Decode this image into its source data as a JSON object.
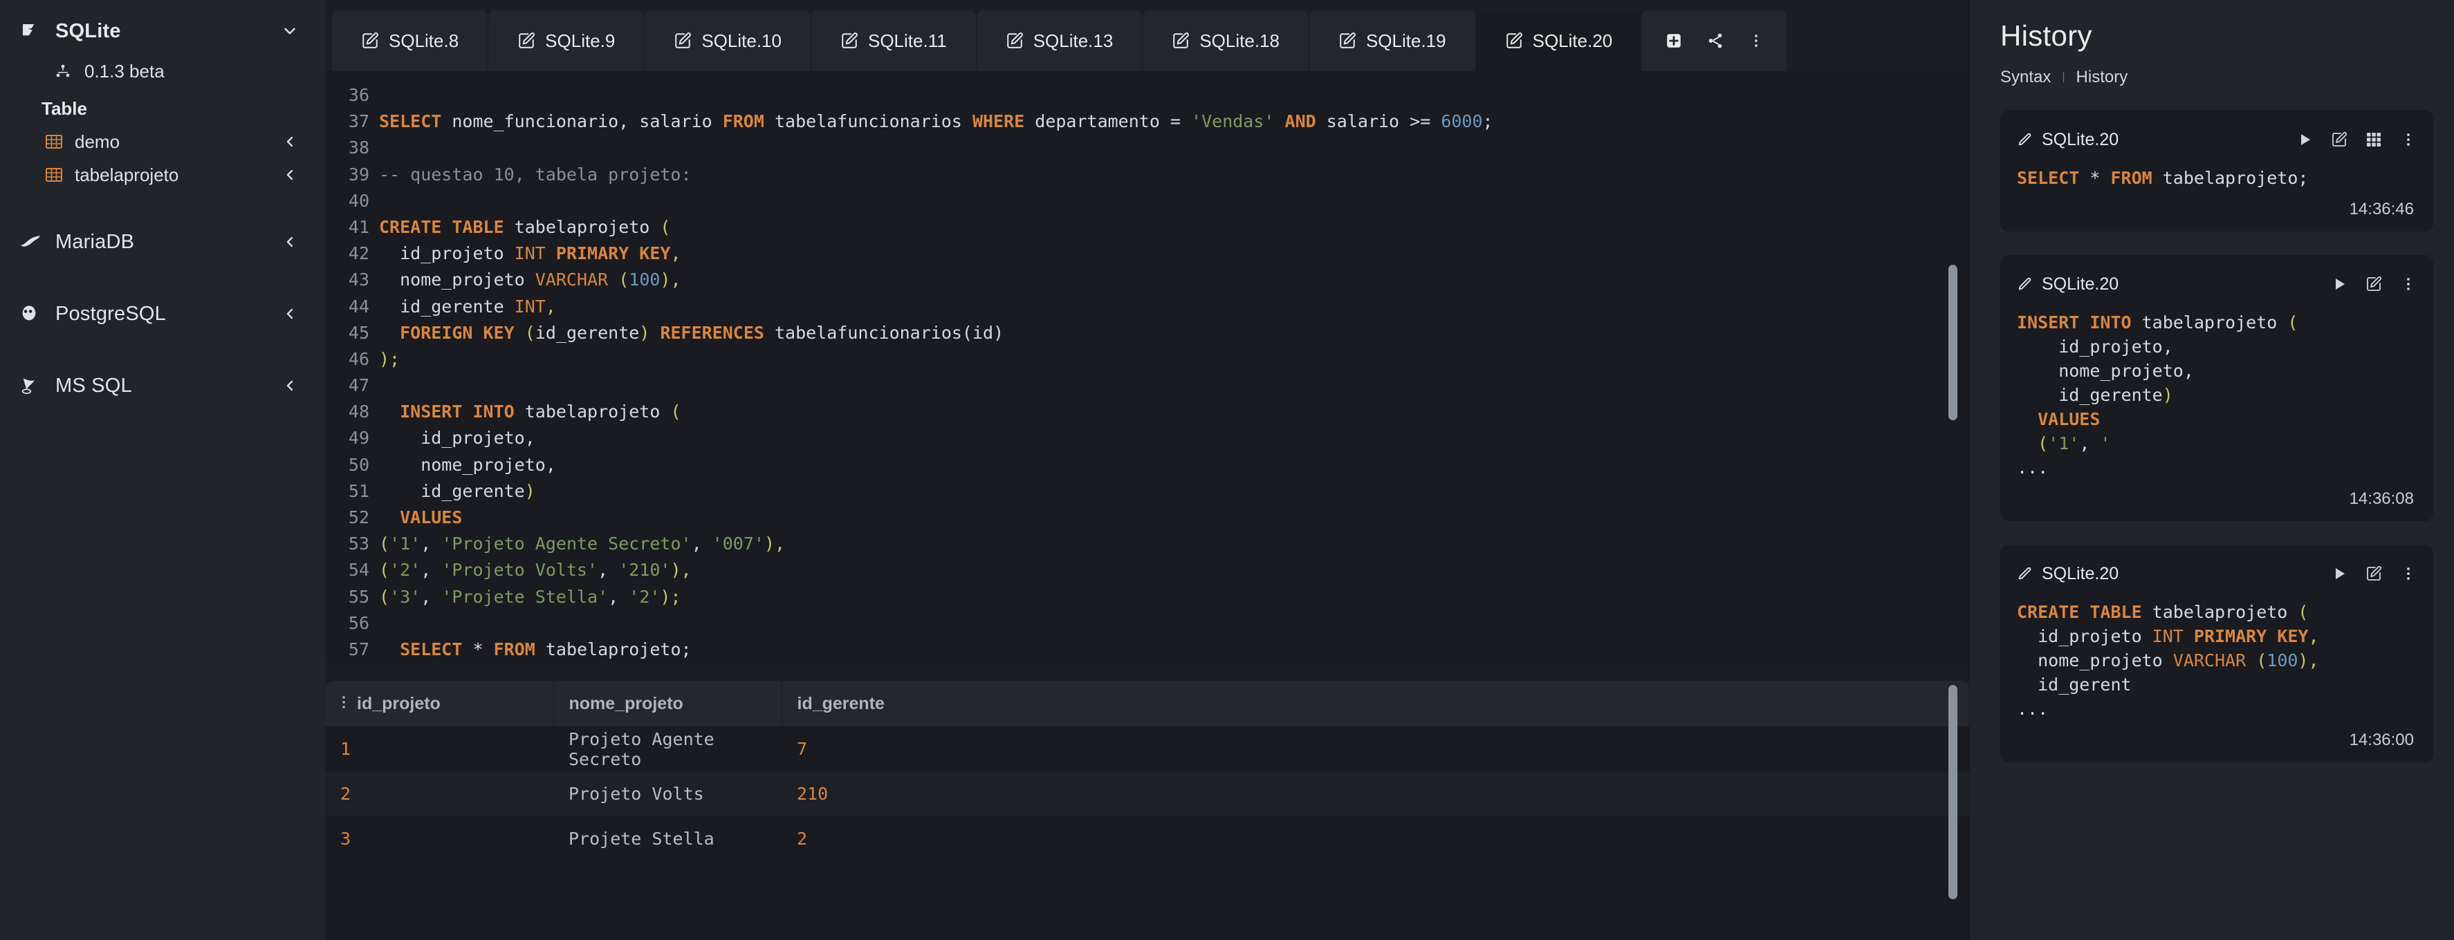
{
  "sidebar": {
    "groups": [
      {
        "name": "SQLite",
        "icon": "sqlite-feather-icon",
        "expanded": true,
        "chevron": "chevron-down-icon",
        "connection": {
          "label": "0.1.3 beta",
          "icon": "connection-node-icon"
        },
        "section_label": "Table",
        "tables": [
          {
            "label": "demo",
            "icon": "table-grid-icon",
            "chevron": "chevron-left-icon"
          },
          {
            "label": "tabelaprojeto",
            "icon": "table-grid-icon",
            "chevron": "chevron-left-icon"
          }
        ]
      },
      {
        "name": "MariaDB",
        "icon": "mariadb-seal-icon",
        "expanded": false,
        "chevron": "chevron-left-icon"
      },
      {
        "name": "PostgreSQL",
        "icon": "postgresql-elephant-icon",
        "expanded": false,
        "chevron": "chevron-left-icon"
      },
      {
        "name": "MS SQL",
        "icon": "mssql-server-icon",
        "expanded": false,
        "chevron": "chevron-left-icon"
      }
    ]
  },
  "tabs": {
    "items": [
      {
        "label": "SQLite.8",
        "icon": "edit-note-icon",
        "active": false
      },
      {
        "label": "SQLite.9",
        "icon": "edit-note-icon",
        "active": false
      },
      {
        "label": "SQLite.10",
        "icon": "edit-note-icon",
        "active": false
      },
      {
        "label": "SQLite.11",
        "icon": "edit-note-icon",
        "active": false
      },
      {
        "label": "SQLite.13",
        "icon": "edit-note-icon",
        "active": false
      },
      {
        "label": "SQLite.18",
        "icon": "edit-note-icon",
        "active": false
      },
      {
        "label": "SQLite.19",
        "icon": "edit-note-icon",
        "active": false
      },
      {
        "label": "SQLite.20",
        "icon": "edit-note-icon",
        "active": true
      }
    ],
    "actions": [
      {
        "name": "add-tab-button",
        "icon": "plus-square-icon"
      },
      {
        "name": "share-button",
        "icon": "share-nodes-icon"
      },
      {
        "name": "more-options-button",
        "icon": "kebab-menu-icon"
      }
    ]
  },
  "editor": {
    "first_line_number": 36,
    "lines": [
      {
        "n": 36,
        "tokens": []
      },
      {
        "n": 37,
        "tokens": [
          {
            "t": "kw",
            "v": "SELECT"
          },
          {
            "t": "pln",
            "v": " nome_funcionario, salario "
          },
          {
            "t": "kw",
            "v": "FROM"
          },
          {
            "t": "pln",
            "v": " tabelafuncionarios "
          },
          {
            "t": "kw",
            "v": "WHERE"
          },
          {
            "t": "pln",
            "v": " departamento = "
          },
          {
            "t": "str",
            "v": "'Vendas'"
          },
          {
            "t": "pln",
            "v": " "
          },
          {
            "t": "kw",
            "v": "AND"
          },
          {
            "t": "pln",
            "v": " salario >= "
          },
          {
            "t": "num",
            "v": "6000"
          },
          {
            "t": "pln",
            "v": ";"
          }
        ]
      },
      {
        "n": 38,
        "tokens": []
      },
      {
        "n": 39,
        "tokens": [
          {
            "t": "com",
            "v": "-- questao 10, tabela projeto:"
          }
        ]
      },
      {
        "n": 40,
        "tokens": []
      },
      {
        "n": 41,
        "tokens": [
          {
            "t": "kw",
            "v": "CREATE TABLE"
          },
          {
            "t": "pln",
            "v": " tabelaprojeto "
          },
          {
            "t": "par",
            "v": "("
          }
        ]
      },
      {
        "n": 42,
        "tokens": [
          {
            "t": "pln",
            "v": "  id_projeto "
          },
          {
            "t": "typ",
            "v": "INT"
          },
          {
            "t": "pln",
            "v": " "
          },
          {
            "t": "kw",
            "v": "PRIMARY KEY"
          },
          {
            "t": "par",
            "v": ","
          }
        ]
      },
      {
        "n": 43,
        "tokens": [
          {
            "t": "pln",
            "v": "  nome_projeto "
          },
          {
            "t": "typ",
            "v": "VARCHAR"
          },
          {
            "t": "pln",
            "v": " "
          },
          {
            "t": "par",
            "v": "("
          },
          {
            "t": "num",
            "v": "100"
          },
          {
            "t": "par",
            "v": "),"
          }
        ]
      },
      {
        "n": 44,
        "tokens": [
          {
            "t": "pln",
            "v": "  id_gerente "
          },
          {
            "t": "typ",
            "v": "INT"
          },
          {
            "t": "par",
            "v": ","
          }
        ]
      },
      {
        "n": 45,
        "tokens": [
          {
            "t": "kw",
            "v": "  FOREIGN KEY"
          },
          {
            "t": "pln",
            "v": " "
          },
          {
            "t": "par",
            "v": "("
          },
          {
            "t": "pln",
            "v": "id_gerente"
          },
          {
            "t": "par",
            "v": ")"
          },
          {
            "t": "pln",
            "v": " "
          },
          {
            "t": "kw",
            "v": "REFERENCES"
          },
          {
            "t": "pln",
            "v": " tabelafuncionarios(id)"
          }
        ]
      },
      {
        "n": 46,
        "tokens": [
          {
            "t": "par",
            "v": ");"
          }
        ]
      },
      {
        "n": 47,
        "tokens": []
      },
      {
        "n": 48,
        "tokens": [
          {
            "t": "kw",
            "v": "  INSERT INTO"
          },
          {
            "t": "pln",
            "v": " tabelaprojeto "
          },
          {
            "t": "par",
            "v": "("
          }
        ]
      },
      {
        "n": 49,
        "tokens": [
          {
            "t": "pln",
            "v": "    id_projeto,"
          }
        ]
      },
      {
        "n": 50,
        "tokens": [
          {
            "t": "pln",
            "v": "    nome_projeto,"
          }
        ]
      },
      {
        "n": 51,
        "tokens": [
          {
            "t": "pln",
            "v": "    id_gerente"
          },
          {
            "t": "par",
            "v": ")"
          }
        ]
      },
      {
        "n": 52,
        "tokens": [
          {
            "t": "kw",
            "v": "  VALUES"
          }
        ]
      },
      {
        "n": 53,
        "tokens": [
          {
            "t": "par",
            "v": "("
          },
          {
            "t": "str",
            "v": "'1'"
          },
          {
            "t": "pln",
            "v": ", "
          },
          {
            "t": "str",
            "v": "'Projeto Agente Secreto'"
          },
          {
            "t": "pln",
            "v": ", "
          },
          {
            "t": "str",
            "v": "'007'"
          },
          {
            "t": "par",
            "v": "),"
          }
        ]
      },
      {
        "n": 54,
        "tokens": [
          {
            "t": "par",
            "v": "("
          },
          {
            "t": "str",
            "v": "'2'"
          },
          {
            "t": "pln",
            "v": ", "
          },
          {
            "t": "str",
            "v": "'Projeto Volts'"
          },
          {
            "t": "pln",
            "v": ", "
          },
          {
            "t": "str",
            "v": "'210'"
          },
          {
            "t": "par",
            "v": "),"
          }
        ]
      },
      {
        "n": 55,
        "tokens": [
          {
            "t": "par",
            "v": "("
          },
          {
            "t": "str",
            "v": "'3'"
          },
          {
            "t": "pln",
            "v": ", "
          },
          {
            "t": "str",
            "v": "'Projete Stella'"
          },
          {
            "t": "pln",
            "v": ", "
          },
          {
            "t": "str",
            "v": "'2'"
          },
          {
            "t": "par",
            "v": ");"
          }
        ]
      },
      {
        "n": 56,
        "tokens": []
      },
      {
        "n": 57,
        "tokens": [
          {
            "t": "kw",
            "v": "  SELECT"
          },
          {
            "t": "pln",
            "v": " * "
          },
          {
            "t": "kw",
            "v": "FROM"
          },
          {
            "t": "pln",
            "v": " tabelaprojeto;"
          }
        ]
      }
    ]
  },
  "results": {
    "columns": [
      "id_projeto",
      "nome_projeto",
      "id_gerente"
    ],
    "rows": [
      [
        "1",
        "Projeto Agente Secreto",
        "7"
      ],
      [
        "2",
        "Projeto Volts",
        "210"
      ],
      [
        "3",
        "Projete Stella",
        "2"
      ]
    ]
  },
  "history": {
    "title": "History",
    "tabs": [
      {
        "label": "Syntax",
        "active": false
      },
      {
        "label": "History",
        "active": true
      }
    ],
    "separator": "|",
    "cards": [
      {
        "title": "SQLite.20",
        "icons": [
          "run-icon",
          "edit-icon",
          "grid-icon",
          "kebab-menu-icon"
        ],
        "time": "14:36:46",
        "sql": [
          [
            {
              "t": "kw",
              "v": "SELECT"
            },
            {
              "t": "pln",
              "v": " * "
            },
            {
              "t": "kw",
              "v": "FROM"
            },
            {
              "t": "pln",
              "v": " tabelaprojeto;"
            }
          ]
        ]
      },
      {
        "title": "SQLite.20",
        "icons": [
          "run-icon",
          "edit-icon",
          "kebab-menu-icon"
        ],
        "time": "14:36:08",
        "sql": [
          [
            {
              "t": "kw",
              "v": "INSERT INTO"
            },
            {
              "t": "pln",
              "v": " tabelaprojeto "
            },
            {
              "t": "par",
              "v": "("
            }
          ],
          [
            {
              "t": "pln",
              "v": "    id_projeto,"
            }
          ],
          [
            {
              "t": "pln",
              "v": "    nome_projeto,"
            }
          ],
          [
            {
              "t": "pln",
              "v": "    id_gerente"
            },
            {
              "t": "par",
              "v": ")"
            }
          ],
          [
            {
              "t": "kw",
              "v": "  VALUES"
            }
          ],
          [
            {
              "t": "par",
              "v": "  ("
            },
            {
              "t": "str",
              "v": "'1'"
            },
            {
              "t": "pln",
              "v": ", "
            },
            {
              "t": "str",
              "v": "'"
            }
          ],
          [
            {
              "t": "pln",
              "v": "..."
            }
          ]
        ]
      },
      {
        "title": "SQLite.20",
        "icons": [
          "run-icon",
          "edit-icon",
          "kebab-menu-icon"
        ],
        "time": "14:36:00",
        "sql": [
          [
            {
              "t": "kw",
              "v": "CREATE TABLE"
            },
            {
              "t": "pln",
              "v": " tabelaprojeto "
            },
            {
              "t": "par",
              "v": "("
            }
          ],
          [
            {
              "t": "pln",
              "v": "  id_projeto "
            },
            {
              "t": "typ",
              "v": "INT"
            },
            {
              "t": "pln",
              "v": " "
            },
            {
              "t": "kw",
              "v": "PRIMARY KEY"
            },
            {
              "t": "par",
              "v": ","
            }
          ],
          [
            {
              "t": "pln",
              "v": "  nome_projeto "
            },
            {
              "t": "typ",
              "v": "VARCHAR"
            },
            {
              "t": "pln",
              "v": " "
            },
            {
              "t": "par",
              "v": "("
            },
            {
              "t": "num",
              "v": "100"
            },
            {
              "t": "par",
              "v": "),"
            }
          ],
          [
            {
              "t": "pln",
              "v": "  id_gerent"
            }
          ],
          [
            {
              "t": "pln",
              "v": "..."
            }
          ]
        ]
      }
    ]
  },
  "colors": {
    "app_bg": "#1b1d22",
    "panel_bg": "#212429",
    "surface_bg": "#191b20",
    "tab_bg": "#23262c",
    "keyword": "#d98540",
    "string": "#7f9a62",
    "number": "#6c99c4",
    "paren": "#c8c96a",
    "comment": "#8b8f97",
    "text": "#d6d9dd",
    "scrollbar": "#8b929c"
  }
}
